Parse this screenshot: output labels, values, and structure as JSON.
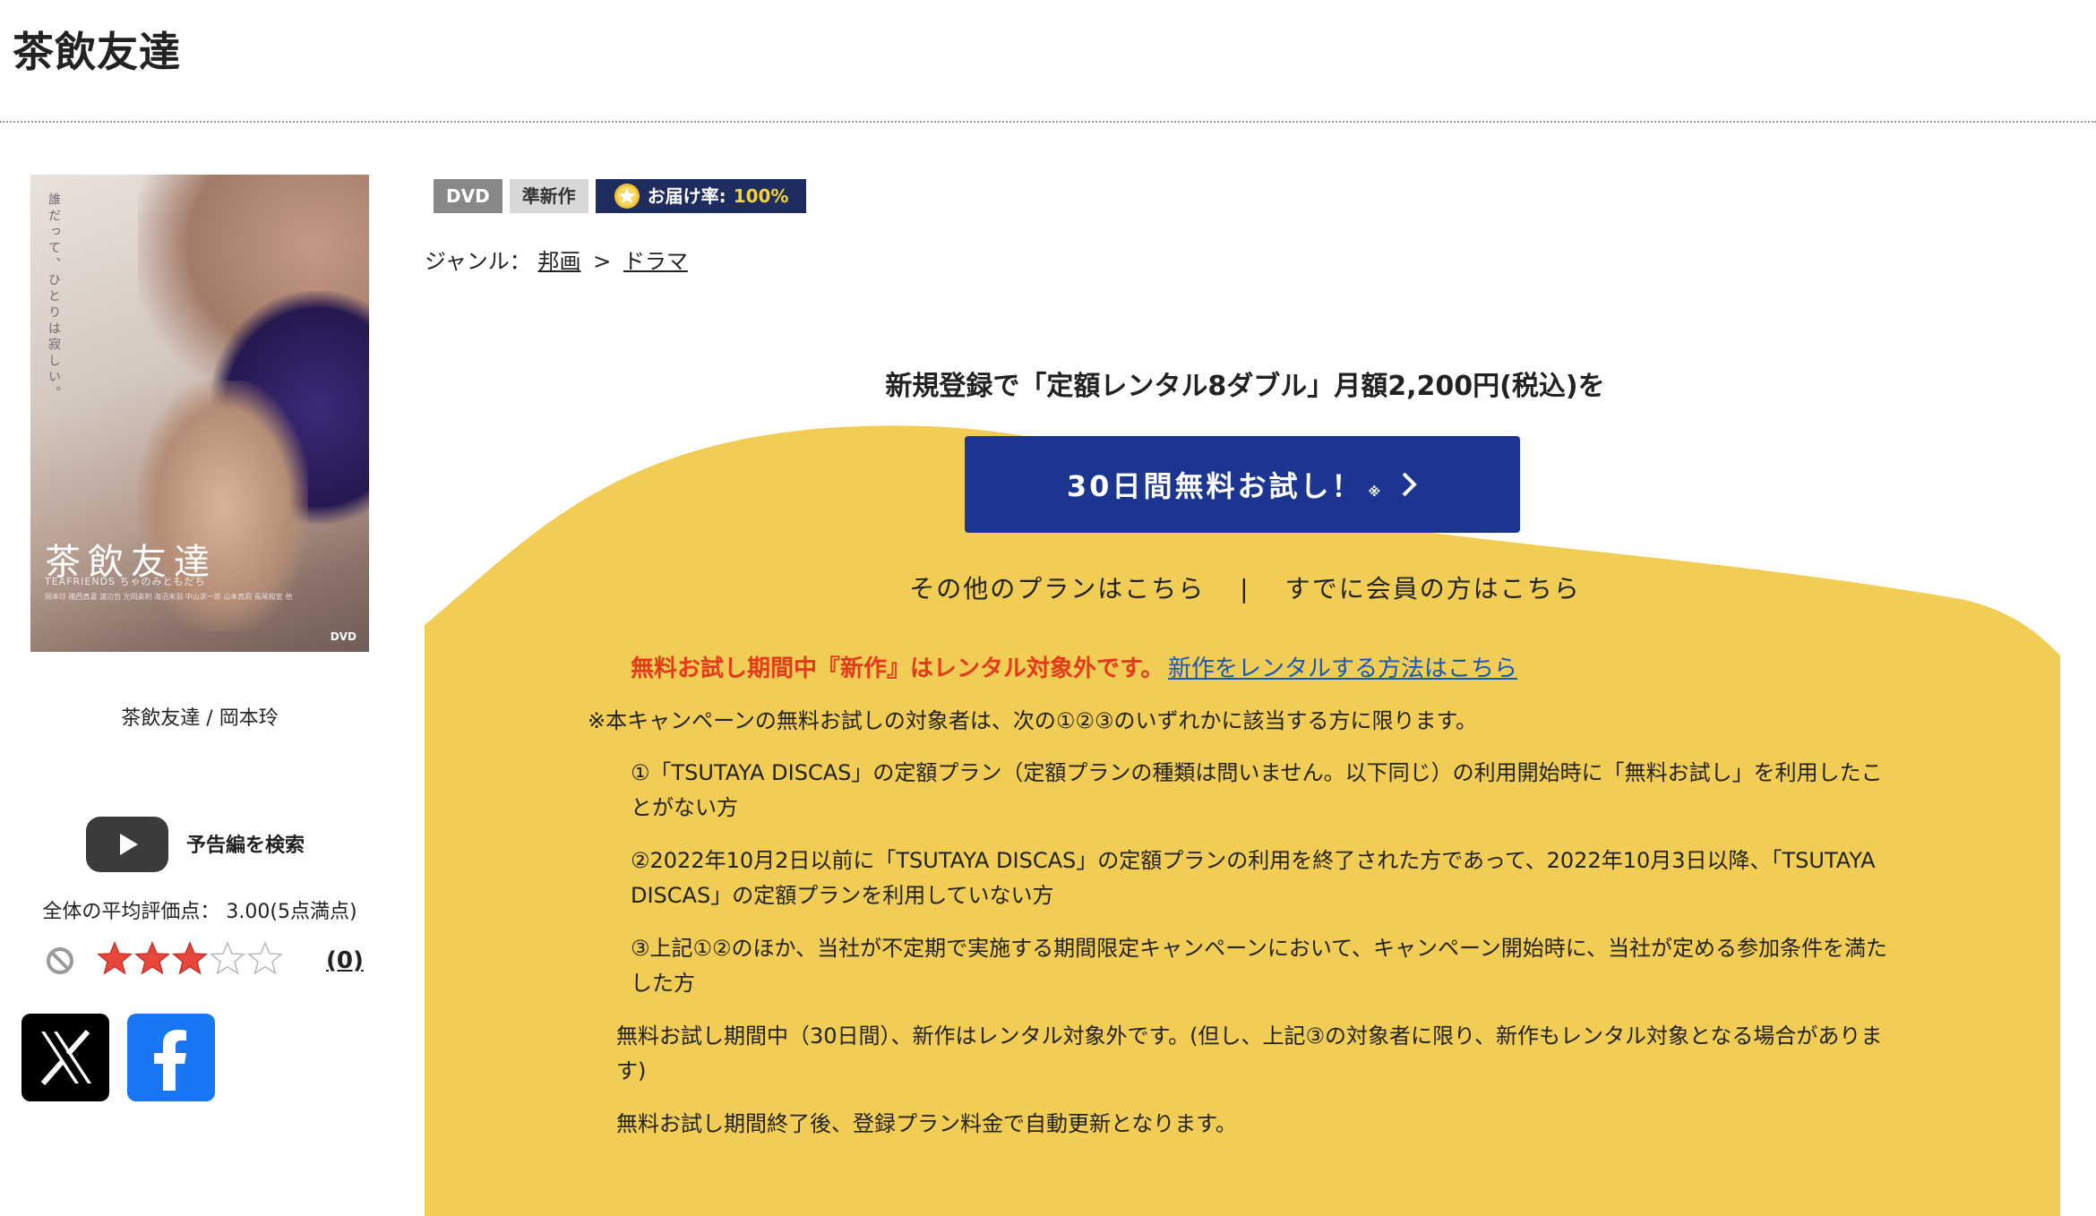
{
  "page": {
    "title": "茶飲友達"
  },
  "poster": {
    "vertical_tagline": "誰だって、ひとりは寂しい。",
    "title": "茶飲友達",
    "subtitle": "TEAFRIENDS ちゃのみともだち",
    "credits": "岡本玲 磯西真喜 渡辺哲 光岡英利 海沼未羽 中山求一郎 山本真莉 長尾和宏 他",
    "format_mark": "DVD"
  },
  "left": {
    "caption": "茶飲友達 / 岡本玲",
    "trailer_label": "予告編を検索",
    "average_label": "全体の平均評価点： 3.00(5点満点)",
    "rating": 3,
    "review_count": "(0)"
  },
  "badges": {
    "format": "DVD",
    "status": "準新作",
    "delivery_label": "お届け率:",
    "delivery_value": "100%"
  },
  "genre": {
    "label": "ジャンル：",
    "items": [
      "邦画",
      "ドラマ"
    ],
    "separator": ">"
  },
  "campaign": {
    "lead": "新規登録で「定額レンタル8ダブル」月額2,200円(税込)を",
    "cta_label": "30日間無料お試し！",
    "cta_note": "※",
    "other_plans": "その他のプランはこちら",
    "divider": "|",
    "member_link": "すでに会員の方はこちら",
    "warning": "無料お試し期間中『新作』はレンタル対象外です。",
    "warning_link": "新作をレンタルする方法はこちら",
    "eligibility_intro": "※本キャンペーンの無料お試しの対象者は、次の①②③のいずれかに該当する方に限ります。",
    "condition1": "①「TSUTAYA DISCAS」の定額プラン（定額プランの種類は問いません。以下同じ）の利用開始時に「無料お試し」を利用したことがない方",
    "condition2": "②2022年10月2日以前に「TSUTAYA DISCAS」の定額プランの利用を終了された方であって、2022年10月3日以降、「TSUTAYA DISCAS」の定額プランを利用していない方",
    "condition3": "③上記①②のほか、当社が不定期で実施する期間限定キャンペーンにおいて、キャンペーン開始時に、当社が定める参加条件を満たした方",
    "note1": "無料お試し期間中（30日間）、新作はレンタル対象外です。(但し、上記③の対象者に限り、新作もレンタル対象となる場合があります)",
    "note2": "無料お試し期間終了後、登録プラン料金で自動更新となります。"
  },
  "colors": {
    "accent_yellow": "#f1cd55",
    "cta_blue": "#1b3590",
    "warning_red": "#e23a1a",
    "link_blue": "#1b57b5",
    "badge_navy": "#1e2d5e",
    "star_red": "#e8473c"
  },
  "icons": {
    "play": "play-icon",
    "ban": "ban-icon",
    "star": "star-icon",
    "x": "x-logo-icon",
    "facebook": "facebook-logo-icon",
    "chevron": "chevron-right-icon",
    "medal": "star-medal-icon"
  }
}
